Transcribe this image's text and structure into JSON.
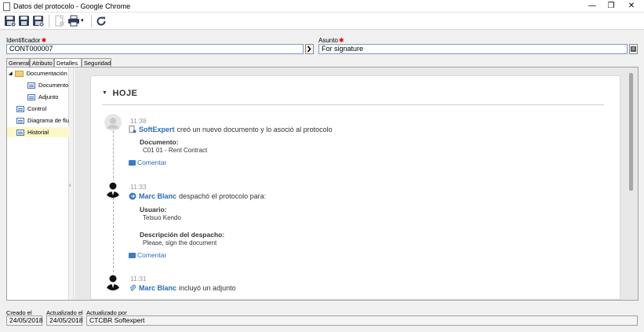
{
  "window": {
    "title": "Datos del protocolo - Google Chrome",
    "minimize": "—",
    "restore": "❐",
    "close": "✕"
  },
  "toolbar": {
    "buttons": [
      "save-new-icon",
      "save-icon",
      "save-close-icon",
      "attach-icon",
      "print-icon",
      "print-dropdown-icon",
      "refresh-icon"
    ]
  },
  "form": {
    "identifier_label": "Identificador",
    "identifier_value": "CONT000007",
    "subject_label": "Asunto",
    "subject_value": "For signature",
    "required_mark": "✱"
  },
  "tabs": [
    "General",
    "Atributo",
    "Detalles",
    "Seguridad"
  ],
  "active_tab": "Detalles",
  "tree": {
    "items": [
      {
        "label": "Documentación",
        "icon": "folder-icon"
      },
      {
        "label": "Documento",
        "icon": "form-icon"
      },
      {
        "label": "Adjunto",
        "icon": "form-icon"
      },
      {
        "label": "Control",
        "icon": "form-icon"
      },
      {
        "label": "Diagrama de flujo",
        "icon": "form-icon"
      },
      {
        "label": "Historial",
        "icon": "form-icon"
      }
    ],
    "expand_glyph": "◢",
    "collapse_glyph": "‹"
  },
  "history": {
    "section_title": "HOJE",
    "caret": "▼",
    "entries": [
      {
        "time": "11:38",
        "who": "SoftExpert",
        "action": "creó un nuevo documento y lo asoció al protocolo",
        "detail_label": "Documento:",
        "detail_value": "C01 01 - Rent Contract",
        "comment": "Comentar"
      },
      {
        "time": "11:33",
        "who": "Marc Blanc",
        "action": "despachó el protocolo para:",
        "detail_label": "Usuario:",
        "detail_value": "Tetsuo Kendo",
        "detail_label_2": "Descripción del despacho:",
        "detail_value_2": "Please, sign the document",
        "comment": "Comentar"
      },
      {
        "time": "11:31",
        "who": "Marc Blanc",
        "action": "incluyó un adjunto"
      }
    ]
  },
  "footer": {
    "created_label": "Creado el",
    "created_value": "24/05/2018",
    "updated_label": "Actualizado el",
    "updated_value": "24/05/2018",
    "updated_by_label": "Actualizado por",
    "updated_by_value": "CTCBR Softexpert"
  },
  "colors": {
    "link": "#2b6cb8",
    "required": "#e00000",
    "selected_row": "#fdf8c8"
  }
}
